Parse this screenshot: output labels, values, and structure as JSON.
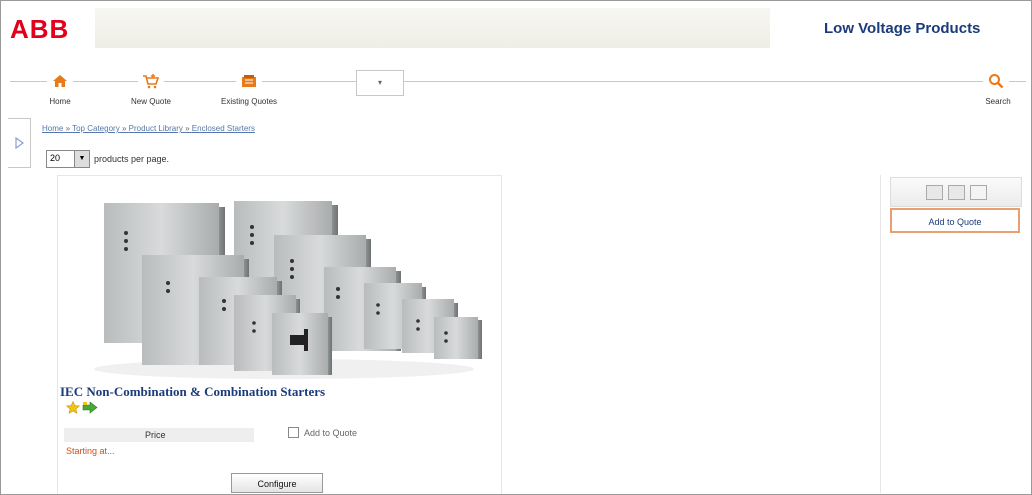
{
  "header": {
    "logo_text": "ABB",
    "app_title": "Low Voltage Products",
    "brand_color": "#e2001a",
    "title_color": "#1b3b7a"
  },
  "nav": {
    "items": [
      {
        "label": "Home",
        "icon": "home-icon"
      },
      {
        "label": "New Quote",
        "icon": "new-quote-icon"
      },
      {
        "label": "Existing Quotes",
        "icon": "existing-quotes-icon"
      }
    ],
    "dropdown_text": "▾",
    "search_label": "Search",
    "nav_icon_color": "#e87a1a"
  },
  "breadcrumb": {
    "items": [
      "Home",
      "Top Category",
      "Product Library",
      "Enclosed Starters"
    ],
    "separator": "»"
  },
  "paging": {
    "per_page_value": "20",
    "per_page_label": "products per page."
  },
  "product": {
    "title": "IEC Non-Combination & Combination Starters",
    "price_header": "Price",
    "price_value": "Starting at...",
    "add_to_quote_checkbox_label": "Add to Quote",
    "configure_label": "Configure",
    "image_icon": "enclosed-starters-product-image"
  },
  "sidebar": {
    "add_to_quote_label": "Add to Quote",
    "view_icons": [
      "grid-view-icon",
      "list-view-icon",
      "detail-view-icon"
    ]
  }
}
